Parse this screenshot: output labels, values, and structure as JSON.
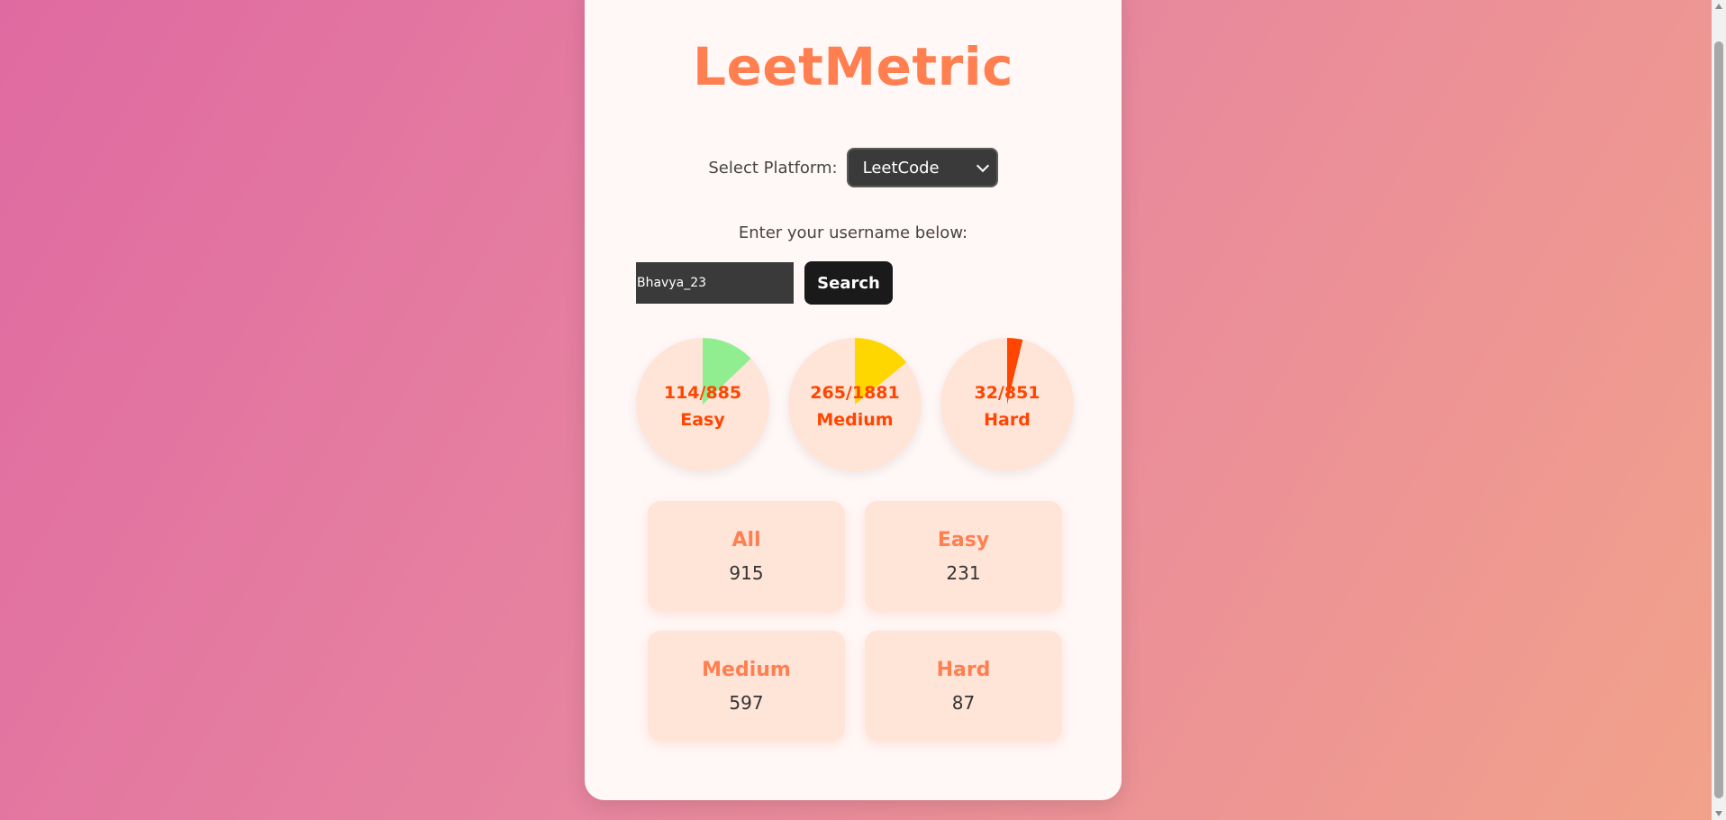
{
  "app": {
    "title": "LeetMetric",
    "platform_label": "Select Platform:",
    "platform_selected": "LeetCode",
    "prompt": "Enter your username below:",
    "username_value": "Bhavya_23",
    "search_label": "Search"
  },
  "progress": [
    {
      "level": "Easy",
      "solved": 114,
      "total": 885,
      "ratio_text": "114/885",
      "color": "#90ee90"
    },
    {
      "level": "Medium",
      "solved": 265,
      "total": 1881,
      "ratio_text": "265/1881",
      "color": "#ffd700"
    },
    {
      "level": "Hard",
      "solved": 32,
      "total": 851,
      "ratio_text": "32/851",
      "color": "#ff4500"
    }
  ],
  "stats": [
    {
      "name": "All",
      "count": "915"
    },
    {
      "name": "Easy",
      "count": "231"
    },
    {
      "name": "Medium",
      "count": "597"
    },
    {
      "name": "Hard",
      "count": "87"
    }
  ],
  "colors": {
    "accent": "#ff7f50",
    "progress_text": "#ff4500",
    "circle_bg": "#ffe4d8"
  }
}
